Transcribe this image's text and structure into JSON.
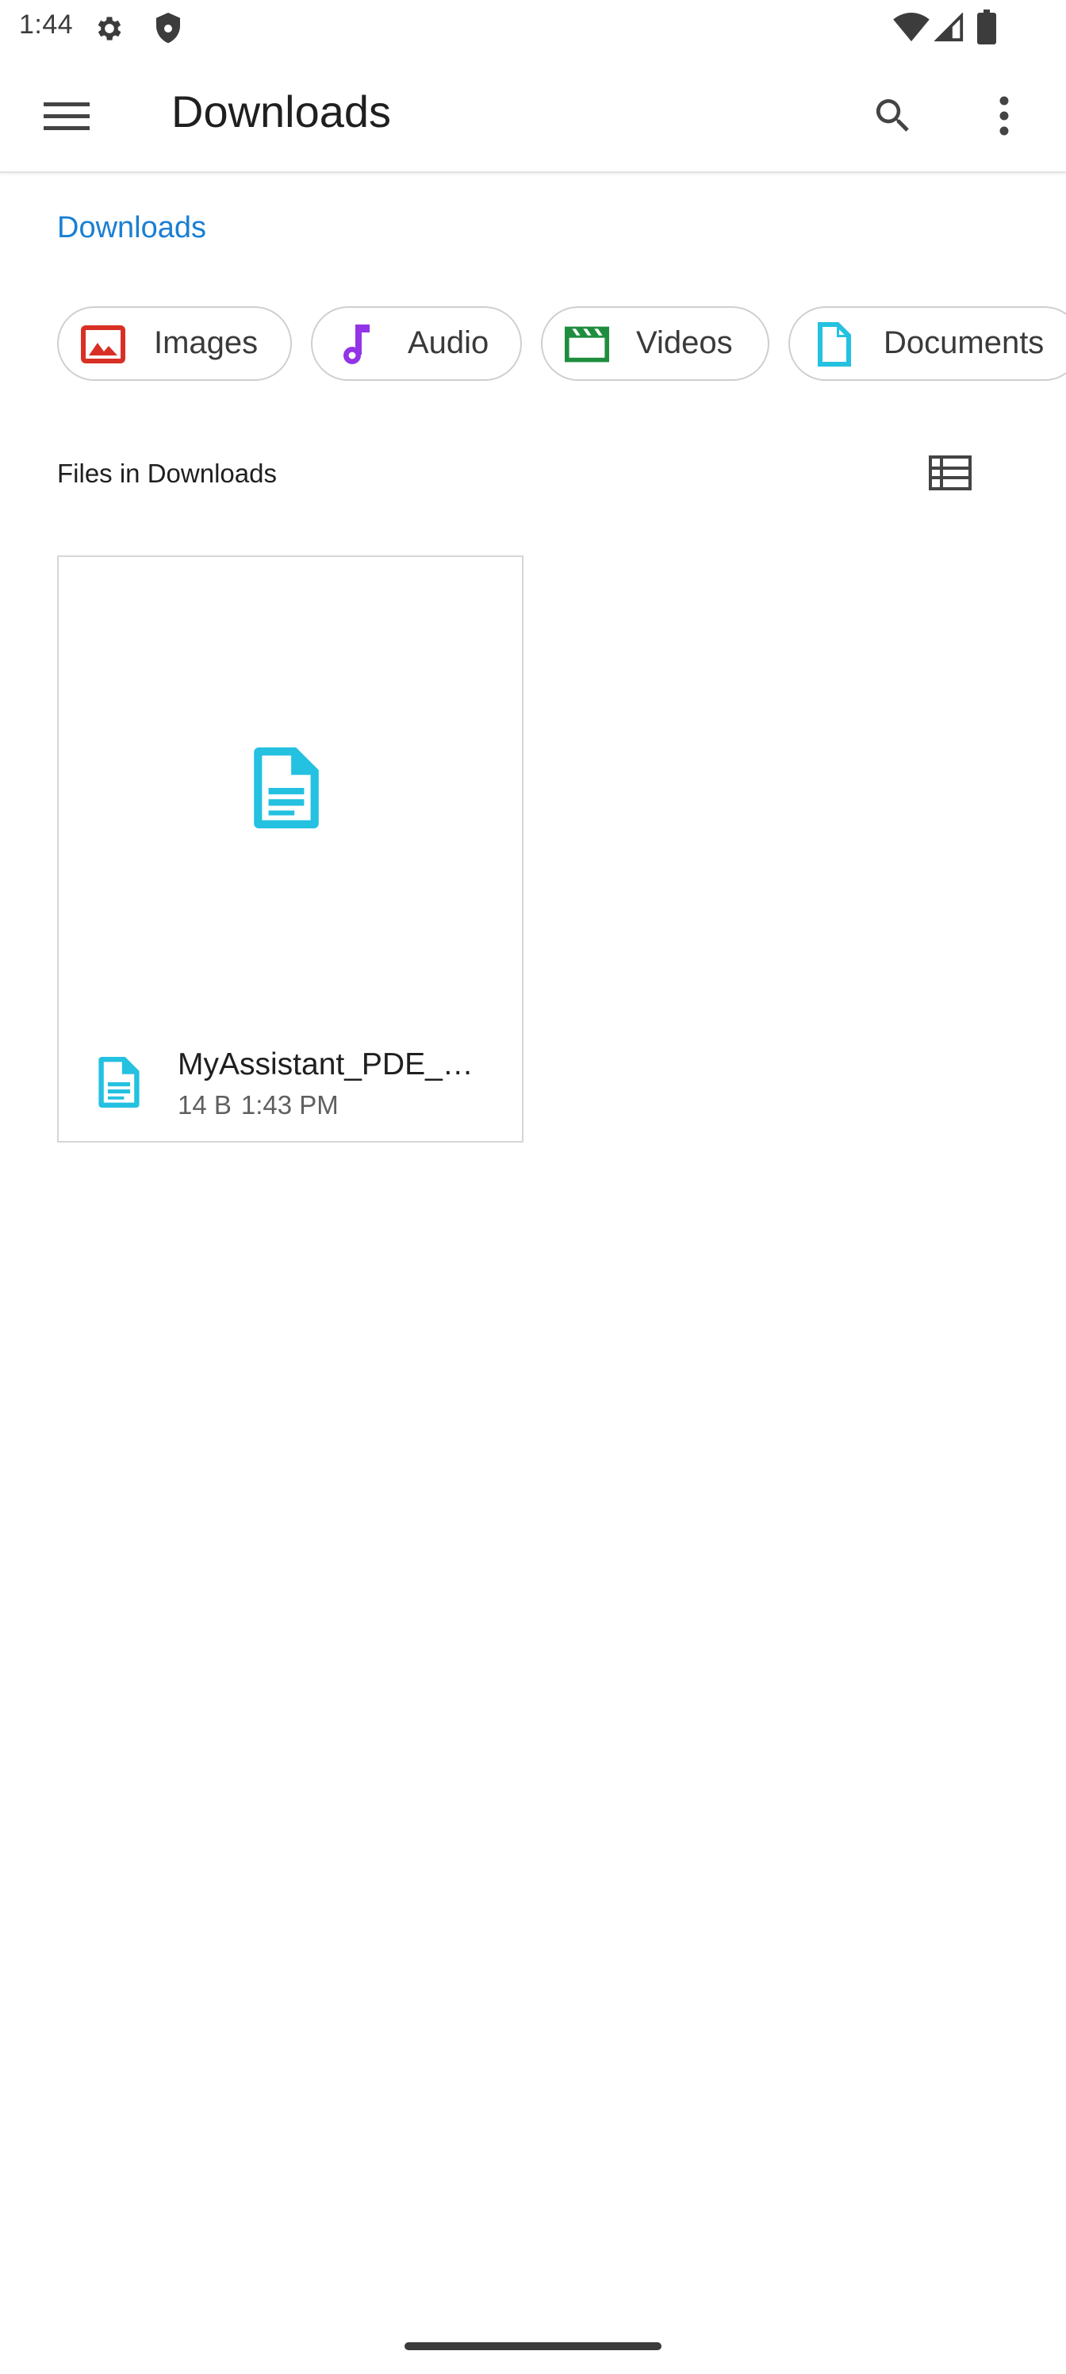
{
  "status_bar": {
    "time": "1:44",
    "icons": [
      "settings-icon",
      "shield-icon",
      "wifi-icon",
      "signal-icon",
      "battery-icon"
    ]
  },
  "app_bar": {
    "title": "Downloads",
    "icons": [
      "menu-icon",
      "search-icon",
      "more-vert-icon"
    ]
  },
  "breadcrumb": {
    "label": "Downloads",
    "color": "#1a7fd3"
  },
  "chips": [
    {
      "label": "Images",
      "icon": "image-icon",
      "color": "#d93025"
    },
    {
      "label": "Audio",
      "icon": "music-note-icon",
      "color": "#9334e6"
    },
    {
      "label": "Videos",
      "icon": "movie-icon",
      "color": "#1e8e3e"
    },
    {
      "label": "Documents",
      "icon": "document-icon",
      "color": "#24c1e0"
    }
  ],
  "section": {
    "title": "Files in Downloads",
    "view_toggle_icon": "list-view-icon"
  },
  "files": [
    {
      "name": "MyAssistant_PDE_…",
      "size": "14 B",
      "time": "1:43 PM",
      "icon": "document-icon",
      "icon_color": "#24c1e0"
    }
  ]
}
